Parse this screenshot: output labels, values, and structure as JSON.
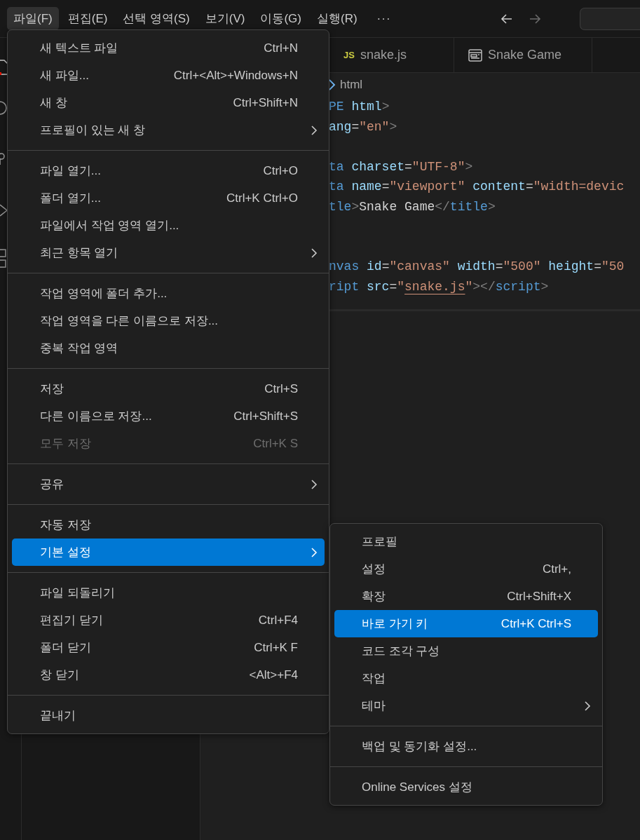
{
  "menubar": {
    "items": [
      {
        "label": "파일(F)",
        "selected": true
      },
      {
        "label": "편집(E)",
        "selected": false
      },
      {
        "label": "선택 영역(S)",
        "selected": false
      },
      {
        "label": "보기(V)",
        "selected": false
      },
      {
        "label": "이동(G)",
        "selected": false
      },
      {
        "label": "실행(R)",
        "selected": false
      }
    ],
    "more": "···",
    "nav": [
      {
        "kind": "back",
        "disabled": false
      },
      {
        "kind": "forward",
        "disabled": true
      }
    ]
  },
  "tabs": [
    {
      "badge": "JS",
      "label": "snake.js",
      "kind": "js",
      "selected": false
    },
    {
      "label": "Snake Game",
      "kind": "preview",
      "selected": false
    }
  ],
  "breadcrumb": "html",
  "code_lines": [
    {
      "kind": "code",
      "tokens": [
        {
          "kind": "tag",
          "text": "PE"
        },
        {
          "kind": "attr",
          "text": " html"
        },
        {
          "kind": "punct",
          "text": ">"
        }
      ]
    },
    {
      "kind": "code",
      "tokens": [
        {
          "kind": "attr",
          "text": "ang"
        },
        {
          "kind": "plain",
          "text": "="
        },
        {
          "kind": "str",
          "text": "\"en\""
        },
        {
          "kind": "punct",
          "text": ">"
        }
      ]
    },
    {
      "kind": "blank"
    },
    {
      "kind": "code",
      "tokens": [
        {
          "kind": "tag",
          "text": "ta"
        },
        {
          "kind": "attr",
          "text": " charset"
        },
        {
          "kind": "plain",
          "text": "="
        },
        {
          "kind": "str",
          "text": "\"UTF-8\""
        },
        {
          "kind": "punct",
          "text": ">"
        }
      ]
    },
    {
      "kind": "code",
      "tokens": [
        {
          "kind": "tag",
          "text": "ta"
        },
        {
          "kind": "attr",
          "text": " name"
        },
        {
          "kind": "plain",
          "text": "="
        },
        {
          "kind": "str",
          "text": "\"viewport\""
        },
        {
          "kind": "attr",
          "text": " content"
        },
        {
          "kind": "plain",
          "text": "="
        },
        {
          "kind": "str",
          "text": "\"width=devic"
        }
      ]
    },
    {
      "kind": "code",
      "tokens": [
        {
          "kind": "tag",
          "text": "tle"
        },
        {
          "kind": "punct",
          "text": ">"
        },
        {
          "kind": "plain",
          "text": "Snake Game"
        },
        {
          "kind": "punct",
          "text": "</"
        },
        {
          "kind": "tag",
          "text": "title"
        },
        {
          "kind": "punct",
          "text": ">"
        }
      ]
    },
    {
      "kind": "blank"
    },
    {
      "kind": "blank"
    },
    {
      "kind": "code",
      "tokens": [
        {
          "kind": "tag",
          "text": "nvas"
        },
        {
          "kind": "attr",
          "text": " id"
        },
        {
          "kind": "plain",
          "text": "="
        },
        {
          "kind": "str",
          "text": "\"canvas\""
        },
        {
          "kind": "attr",
          "text": " width"
        },
        {
          "kind": "plain",
          "text": "="
        },
        {
          "kind": "str",
          "text": "\"500\""
        },
        {
          "kind": "attr",
          "text": " height"
        },
        {
          "kind": "plain",
          "text": "="
        },
        {
          "kind": "str",
          "text": "\"50"
        }
      ]
    },
    {
      "kind": "code",
      "tokens": [
        {
          "kind": "tag",
          "text": "ript"
        },
        {
          "kind": "attr",
          "text": " src"
        },
        {
          "kind": "plain",
          "text": "="
        },
        {
          "kind": "str",
          "text": "\""
        },
        {
          "kind": "link",
          "text": "snake.js"
        },
        {
          "kind": "str",
          "text": "\""
        },
        {
          "kind": "punct",
          "text": "></"
        },
        {
          "kind": "tag",
          "text": "script"
        },
        {
          "kind": "punct",
          "text": ">"
        }
      ]
    }
  ],
  "file_menu": {
    "groups": [
      [
        {
          "label": "새 텍스트 파일",
          "shortcut": "Ctrl+N",
          "has_submenu": false,
          "disabled": false,
          "selected": false
        },
        {
          "label": "새 파일...",
          "shortcut": "Ctrl+<Alt>+Windows+N",
          "has_submenu": false,
          "disabled": false,
          "selected": false
        },
        {
          "label": "새 창",
          "shortcut": "Ctrl+Shift+N",
          "has_submenu": false,
          "disabled": false,
          "selected": false
        },
        {
          "label": "프로필이 있는 새 창",
          "has_submenu": true,
          "disabled": false,
          "selected": false
        }
      ],
      [
        {
          "label": "파일 열기...",
          "shortcut": "Ctrl+O",
          "has_submenu": false,
          "disabled": false,
          "selected": false
        },
        {
          "label": "폴더 열기...",
          "shortcut": "Ctrl+K Ctrl+O",
          "has_submenu": false,
          "disabled": false,
          "selected": false
        },
        {
          "label": "파일에서 작업 영역 열기...",
          "has_submenu": false,
          "disabled": false,
          "selected": false
        },
        {
          "label": "최근 항목 열기",
          "has_submenu": true,
          "disabled": false,
          "selected": false
        }
      ],
      [
        {
          "label": "작업 영역에 폴더 추가...",
          "has_submenu": false,
          "disabled": false,
          "selected": false
        },
        {
          "label": "작업 영역을 다른 이름으로 저장...",
          "has_submenu": false,
          "disabled": false,
          "selected": false
        },
        {
          "label": "중복 작업 영역",
          "has_submenu": false,
          "disabled": false,
          "selected": false
        }
      ],
      [
        {
          "label": "저장",
          "shortcut": "Ctrl+S",
          "has_submenu": false,
          "disabled": false,
          "selected": false
        },
        {
          "label": "다른 이름으로 저장...",
          "shortcut": "Ctrl+Shift+S",
          "has_submenu": false,
          "disabled": false,
          "selected": false
        },
        {
          "label": "모두 저장",
          "shortcut": "Ctrl+K S",
          "has_submenu": false,
          "disabled": true,
          "selected": false
        }
      ],
      [
        {
          "label": "공유",
          "has_submenu": true,
          "disabled": false,
          "selected": false
        }
      ],
      [
        {
          "label": "자동 저장",
          "has_submenu": false,
          "disabled": false,
          "selected": false
        },
        {
          "label": "기본 설정",
          "has_submenu": true,
          "disabled": false,
          "selected": true
        }
      ],
      [
        {
          "label": "파일 되돌리기",
          "has_submenu": false,
          "disabled": false,
          "selected": false
        },
        {
          "label": "편집기 닫기",
          "shortcut": "Ctrl+F4",
          "has_submenu": false,
          "disabled": false,
          "selected": false
        },
        {
          "label": "폴더 닫기",
          "shortcut": "Ctrl+K F",
          "has_submenu": false,
          "disabled": false,
          "selected": false
        },
        {
          "label": "창 닫기",
          "shortcut": "<Alt>+F4",
          "has_submenu": false,
          "disabled": false,
          "selected": false
        }
      ],
      [
        {
          "label": "끝내기",
          "has_submenu": false,
          "disabled": false,
          "selected": false
        }
      ]
    ]
  },
  "preferences_submenu": {
    "groups": [
      [
        {
          "label": "프로필",
          "has_submenu": false,
          "disabled": false,
          "selected": false
        },
        {
          "label": "설정",
          "shortcut": "Ctrl+,",
          "has_submenu": false,
          "disabled": false,
          "selected": false
        },
        {
          "label": "확장",
          "shortcut": "Ctrl+Shift+X",
          "has_submenu": false,
          "disabled": false,
          "selected": false
        },
        {
          "label": "바로 가기 키",
          "shortcut": "Ctrl+K Ctrl+S",
          "has_submenu": false,
          "disabled": false,
          "selected": true
        },
        {
          "label": "코드 조각 구성",
          "has_submenu": false,
          "disabled": false,
          "selected": false
        },
        {
          "label": "작업",
          "has_submenu": false,
          "disabled": false,
          "selected": false
        },
        {
          "label": "테마",
          "has_submenu": true,
          "disabled": false,
          "selected": false
        }
      ],
      [
        {
          "label": "백업 및 동기화 설정...",
          "has_submenu": false,
          "disabled": false,
          "selected": false
        }
      ],
      [
        {
          "label": "Online Services 설정",
          "has_submenu": false,
          "disabled": false,
          "selected": false
        }
      ]
    ]
  }
}
